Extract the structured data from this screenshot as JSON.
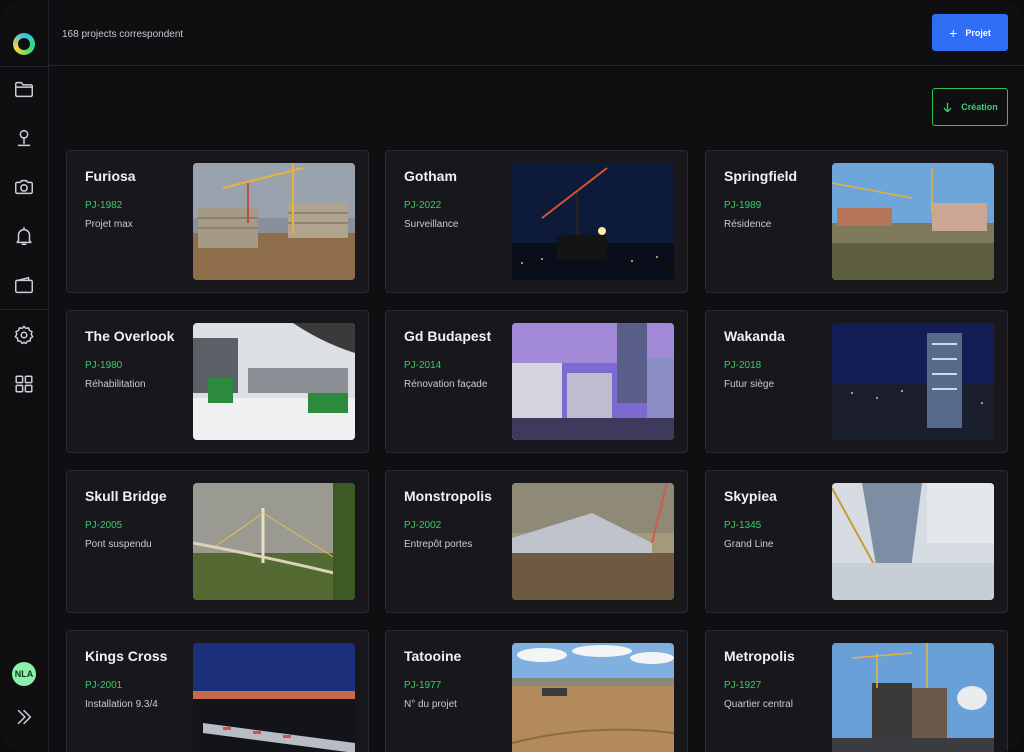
{
  "header": {
    "count_text": "168 projects correspondent",
    "new_project_label": "Projet",
    "sort_label": "Création"
  },
  "sidebar": {
    "items": [
      {
        "name": "folder-icon"
      },
      {
        "name": "location-pin-icon"
      },
      {
        "name": "camera-icon"
      },
      {
        "name": "bell-icon"
      },
      {
        "name": "wallet-icon"
      },
      {
        "name": "settings-icon"
      },
      {
        "name": "grid-icon"
      }
    ],
    "user_initials": "NLA"
  },
  "colors": {
    "accent_blue": "#2f6df5",
    "accent_green": "#2fd166",
    "card_bg": "#18181c"
  },
  "projects": [
    {
      "title": "Furiosa",
      "code": "PJ-1982",
      "description": "Projet max"
    },
    {
      "title": "Gotham",
      "code": "PJ-2022",
      "description": "Surveillance"
    },
    {
      "title": "Springfield",
      "code": "PJ-1989",
      "description": "Résidence"
    },
    {
      "title": "The Overlook",
      "code": "PJ-1980",
      "description": "Réhabilitation"
    },
    {
      "title": "Gd Budapest",
      "code": "PJ-2014",
      "description": "Rénovation façade"
    },
    {
      "title": "Wakanda",
      "code": "PJ-2018",
      "description": "Futur siège"
    },
    {
      "title": "Skull Bridge",
      "code": "PJ-2005",
      "description": "Pont suspendu"
    },
    {
      "title": "Monstropolis",
      "code": "PJ-2002",
      "description": "Entrepôt portes"
    },
    {
      "title": "Skypiea",
      "code": "PJ-1345",
      "description": "Grand Line"
    },
    {
      "title": "Kings Cross",
      "code": "PJ-2001",
      "description": "Installation 9.3/4"
    },
    {
      "title": "Tatooine",
      "code": "PJ-1977",
      "description": "N° du projet"
    },
    {
      "title": "Metropolis",
      "code": "PJ-1927",
      "description": "Quartier central"
    }
  ]
}
